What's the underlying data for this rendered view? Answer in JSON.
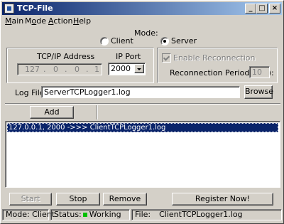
{
  "window": {
    "title": "TCP-File",
    "minimize": "_",
    "maximize": "□",
    "close": "×"
  },
  "menu": [
    {
      "u": "M",
      "rest": "ain"
    },
    {
      "pre": "M",
      "u": "o",
      "rest": "de"
    },
    {
      "u": "A",
      "rest": "ction"
    },
    {
      "u": "H",
      "rest": "elp"
    }
  ],
  "mode": {
    "label": "Mode:",
    "client": "Client",
    "server": "Server",
    "selected": "server"
  },
  "connection": {
    "address_label": "TCP/IP Address",
    "address": [
      "127",
      "0",
      "0",
      "1"
    ],
    "port_label": "IP Port",
    "port": "2000",
    "enable_reconnection": "Enable Reconnection",
    "reconnection_period_label": "Reconnection Period (sec):",
    "reconnection_period": "10"
  },
  "log": {
    "label": "Log File:",
    "value": "ServerTCPLogger1.log",
    "browse": "Browse"
  },
  "add_button": "Add",
  "list": [
    "127.0.0.1, 2000  ->>> ClientTCPLogger1.log"
  ],
  "actions": {
    "start": "Start",
    "stop": "Stop",
    "remove": "Remove",
    "register": "Register Now!"
  },
  "status": {
    "mode": "Mode:  Client",
    "status_label": "Status:",
    "status_value": "Working",
    "status_color": "#00c000",
    "file_label": "File:",
    "file_value": "ClientTCPLogger1.log"
  }
}
